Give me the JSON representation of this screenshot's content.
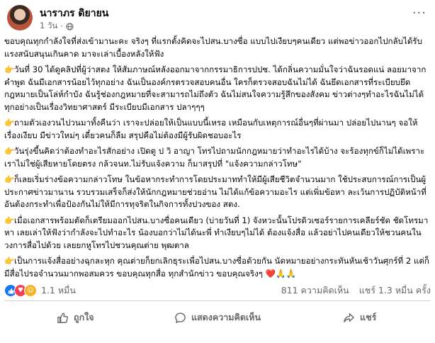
{
  "post": {
    "author": "นาราภร ดิยายน",
    "time": "1 วัน",
    "dot": "·",
    "paragraphs": [
      {
        "emoji": "",
        "text": "ขอบคุณทุกกำลังใจที่ส่งเข้ามานะคะ จริงๆ ที่แรกตั้งคิดจะไปสน.บางซื่อ แบบไปเงียบๆคนเดียว แต่พอข่าวออกไปกลับได้รับแรงสนับสนุนเกินคาด มาจะเล่าเบื้องหลังให้ฟัง"
      },
      {
        "emoji": "👉",
        "text": "วันที่ 30 ได้ดูคลิปที่ผู้ว่าสตง ให้สัมภาษณ์หลังออกมาจากกรรมาธิการปปช. ได้กลิ่นความมั่นใจว่าฉันรอดแน่ ลอยมาจากคำพูด ฉันมีเอกสารน้อยไว้ทุกอย่าง ฉันเป็นองค์กรตรวจสอบคนอื่น ใครก็ตรวจสอบฉันไม่ได้ ฉันยึดเอกสารที่ระเบียบยึดกฎหมายเป็นโล่ห์กำบัง ฉันรู้ช่องกฎหมายที่จะสามารถไม่ถึงตัว ฉันไม่สนใจความรู้สึกของสังคม ข่าวต่างๆทำอะไรฉันไม่ได้ ทุกอย่างเป็นเรื่องวิทยาศาสตร์ มีระเบียบมีเอกสาร ปลาๆๆๆ"
      },
      {
        "emoji": "👉",
        "text": "ถามตัวเองวนไปวนมาทั้งคืนว่า เราจะปล่อยให้เป็นแบบนี้เหรอ เหมือนกับเหตุการณ์อื่นๆที่ผ่านมา ปล่อยไปนานๆ จอให้เรื่องเงียบ มีข่าวใหม่ๆ เดี๋ยวคนก็ลืม สรุปคือไม่ต้องมีผู้รับผิดชอบอะไร"
      },
      {
        "emoji": "👉",
        "text": "วันรุ่งขึ้นคิดว่าต้องทำอะไรสักอย่าง เปิดดู ป วิ อาญา โทรไปถามนักกฎหมายว่าทำอะไรได้บ้าง จะร้องทุกข์ก็ไม่ได้เพราะเราไม่ใช่ผู้เสียหายโดยตรง กล้วจนท.ไม่รับแจ้งความ ก็มาสรุปที่ \"แจ้งความกล่าวโทษ\""
      },
      {
        "emoji": "👉",
        "text": "ก็เลยเริ่มร่างข้อความกล่าวโทษ ในข้อหากระทำการโดยประมาททำให้มีผู้เสียชีวิตจำนวนมาก ใช้ประสบการณ์การเป็นผู้ประกาศข่าวมานาน รวบรวมเสร็จก็ส่งให้นักกฎหมายช่วยอ่าน ไม่ได้แก้ข้อความอะไร แต่เพิ่มข้อหา ละเว้นการปฏิบัติหน้าที่อันต้องกระทำเพื่อป้องกันไม่ให้มีการทุจริตในกิจการทั้งปวงของ สตง."
      },
      {
        "emoji": "👉",
        "text": "เมื่อเอกสารพร้อมตัดก็เตรียมออกไปสน.บางซื่อคนเดียว (บ่ายวันที่ 1) จังหวะนั้นโปรดิวเซอร์รายการเคลียร์ชัด ชัดโทรมาหา เลยเล่าให้ฟังว่ากำลังจะไปทำอะไร น้องบอกว่าไม่ได้นะพี่ ทำเงียบๆไม่ได้ ต้องแจ้งสื่อ แล้วอย่าไปคนเดียวให้ชวนคนในวงการสื่อไปด้วย เลยยกหูโทรไปชวนคุณต่าย พุฒตาล"
      },
      {
        "emoji": "👉",
        "text": "เป็นการแจ้งสื่ออย่างฉุกละหุก คุณต่ายก็ยกเลิกธุระเพื่อไปสน.บางซื่อด้วยกัน นัดหมายอย่างกระทันหันเช้าวันศุกร์ที่ 2 แต่ก็มีสื่อไปรอจำนวนมากพอสมควร ขอบคุณทุกสื่อ ทุกสำนักข่าว ขอบคุณจริงๆ",
        "tail_heart": "❤️",
        "tail_pray": "🙏🙏"
      }
    ]
  },
  "stats": {
    "reaction_count": "1.1 หมื่น",
    "comments": "811 ความคิดเห็น",
    "shares": "แชร์ 1.3 หมื่น ครั้ง"
  },
  "actions": {
    "like": "ถูกใจ",
    "comment": "แสดงความคิดเห็น",
    "share": "แชร์"
  },
  "colors": {
    "accent": "#1877f2",
    "love": "#f33e58",
    "care": "#f7b125",
    "muted": "#65676b"
  }
}
